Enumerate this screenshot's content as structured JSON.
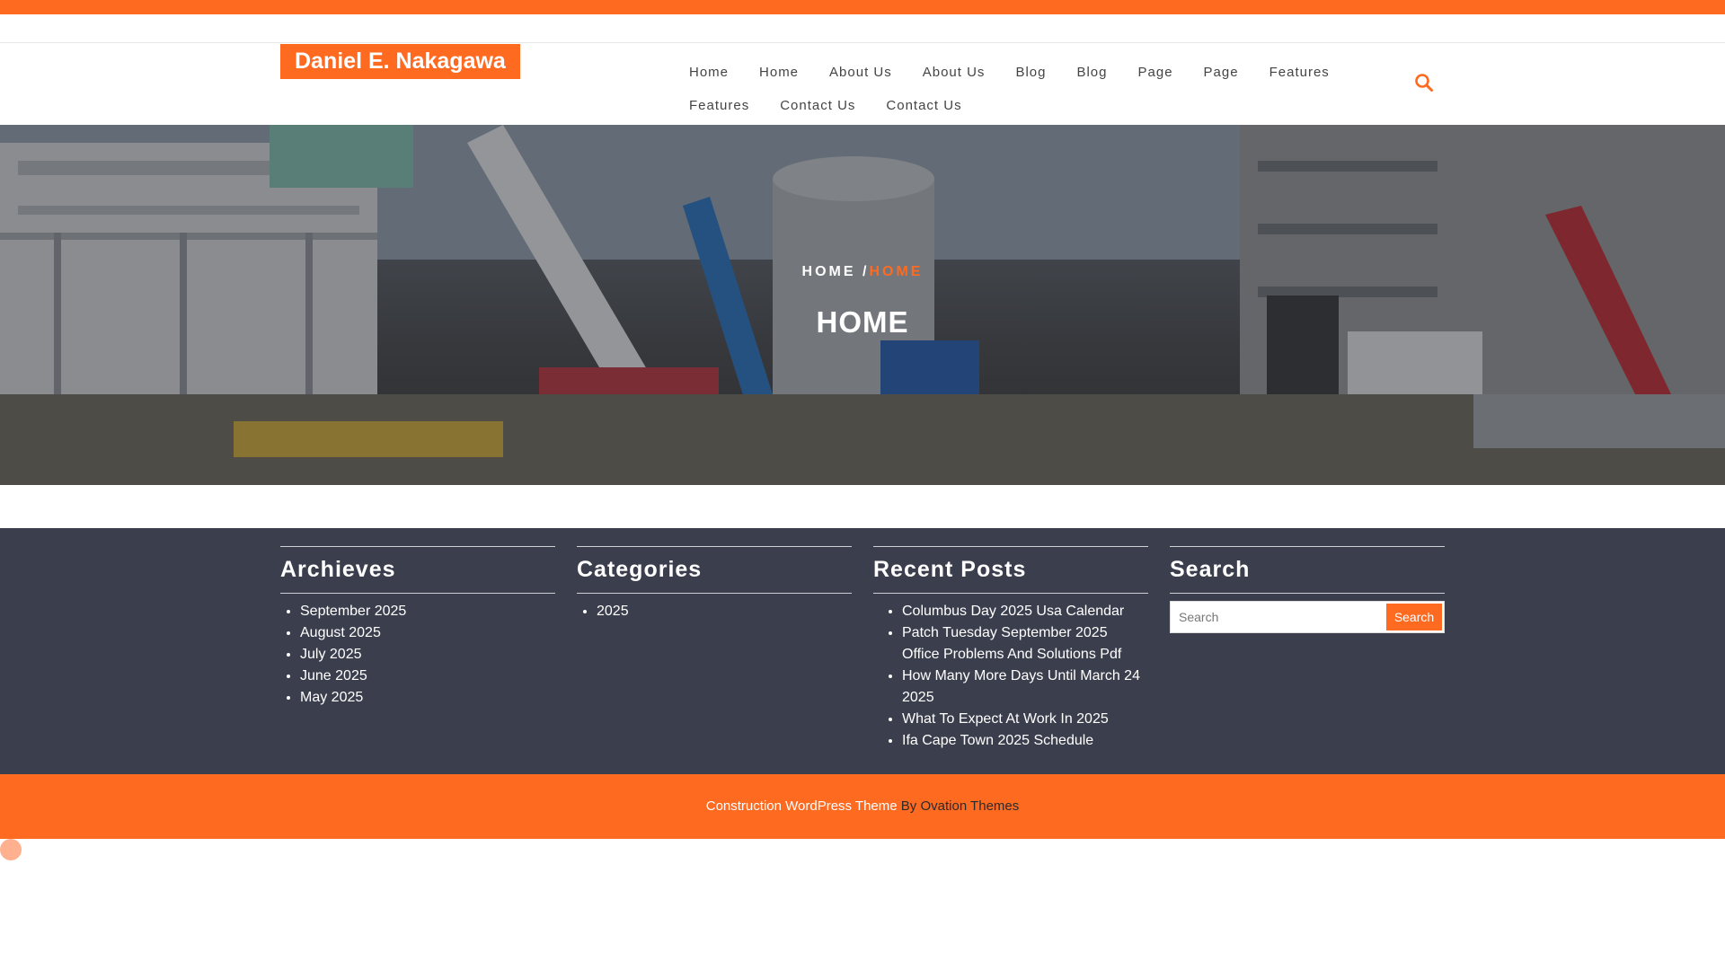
{
  "site": {
    "title": "Daniel E. Nakagawa"
  },
  "nav": {
    "row1": [
      "Home",
      "Home",
      "About Us",
      "About Us",
      "Blog",
      "Blog",
      "Page",
      "Page",
      "Features"
    ],
    "row2": [
      "Features",
      "Contact Us",
      "Contact Us"
    ]
  },
  "hero": {
    "breadcrumb_home": "HOME",
    "breadcrumb_sep": "/",
    "breadcrumb_current": "HOME",
    "title": "HOME"
  },
  "widgets": {
    "archives": {
      "title": "Archieves",
      "items": [
        "September 2025",
        "August 2025",
        "July 2025",
        "June 2025",
        "May 2025"
      ]
    },
    "categories": {
      "title": "Categories",
      "items": [
        "2025"
      ]
    },
    "recent_posts": {
      "title": "Recent Posts",
      "items": [
        "Columbus Day 2025 Usa Calendar",
        "Patch Tuesday September 2025 Office Problems And Solutions Pdf",
        "How Many More Days Until March 24 2025",
        "What To Expect At Work In 2025",
        "Ifa Cape Town 2025 Schedule"
      ]
    },
    "search": {
      "title": "Search",
      "placeholder": "Search",
      "button_label": "Search"
    }
  },
  "footer": {
    "link": "Construction WordPress Theme",
    "by": "By Ovation Themes"
  },
  "colors": {
    "accent": "#ff6a21",
    "widgets_bg": "#3b3e4d"
  },
  "icons": {
    "header_search": "search-icon",
    "scroll_top": "scroll-to-top-icon"
  }
}
